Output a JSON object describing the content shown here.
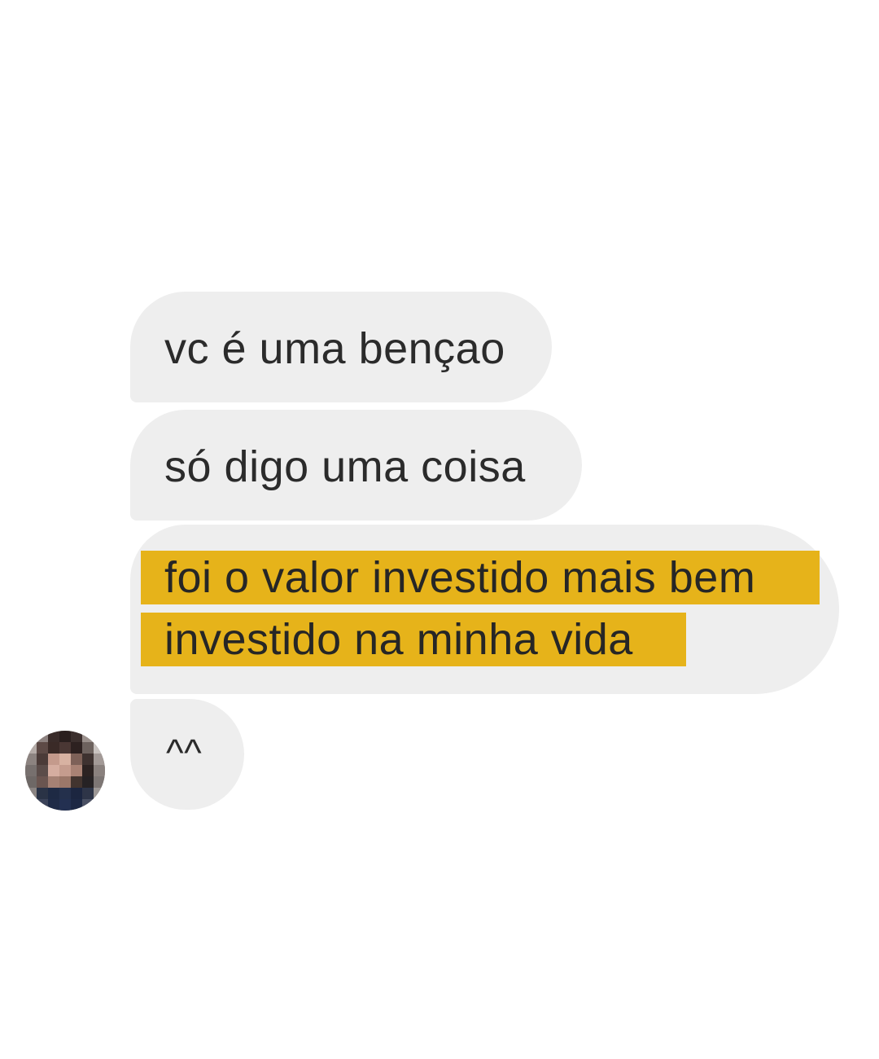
{
  "messages": [
    {
      "text": "vc é uma bençao"
    },
    {
      "text": "só digo uma coisa"
    },
    {
      "lines": [
        "foi o valor investido mais bem",
        "investido na minha vida"
      ],
      "highlight_color": "#e6b31a"
    },
    {
      "text": "^^"
    }
  ],
  "colors": {
    "bubble_background": "#eeeeee",
    "highlight": "#e6b31a",
    "text": "#2b2b2b",
    "page_background": "#ffffff"
  },
  "avatar": {
    "icon": "pixelated-user-avatar"
  }
}
